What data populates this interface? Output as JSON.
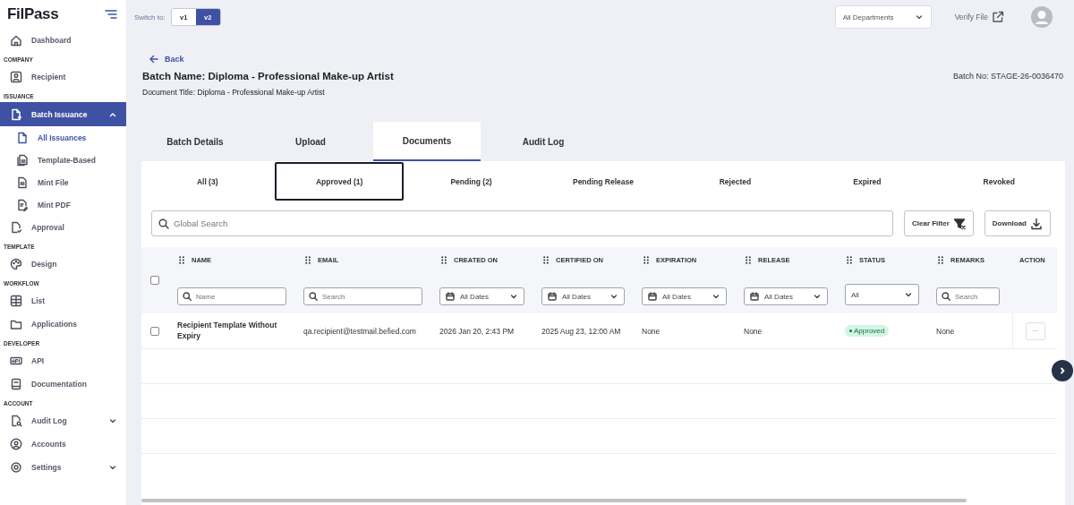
{
  "sidebar": {
    "logo": "FilPass",
    "groups": [
      {
        "items": [
          {
            "label": "Dashboard",
            "selected": false
          }
        ]
      },
      {
        "heading": "COMPANY",
        "items": [
          {
            "label": "Recipient",
            "selected": false
          }
        ]
      },
      {
        "heading": "ISSUANCE",
        "items": [
          {
            "label": "Batch Issuance",
            "selected": true,
            "expanded": true,
            "children": [
              {
                "label": "All Issuances",
                "selected": true
              },
              {
                "label": "Template-Based",
                "selected": false
              },
              {
                "label": "Mint File",
                "selected": false
              },
              {
                "label": "Mint PDF",
                "selected": false
              }
            ]
          },
          {
            "label": "Approval",
            "selected": false
          }
        ]
      },
      {
        "heading": "TEMPLATE",
        "items": [
          {
            "label": "Design",
            "selected": false
          }
        ]
      },
      {
        "heading": "WORKFLOW",
        "items": [
          {
            "label": "List",
            "selected": false
          },
          {
            "label": "Applications",
            "selected": false
          }
        ]
      },
      {
        "heading": "DEVELOPER",
        "items": [
          {
            "label": "API",
            "selected": false
          },
          {
            "label": "Documentation",
            "selected": false
          }
        ]
      },
      {
        "heading": "ACCOUNT",
        "items": [
          {
            "label": "Audit Log",
            "selected": false,
            "expanded": false
          },
          {
            "label": "Accounts",
            "selected": false
          },
          {
            "label": "Settings",
            "selected": false,
            "expanded": false
          }
        ]
      }
    ]
  },
  "topbar": {
    "switch_label": "Switch to:",
    "versions": [
      {
        "label": "v1",
        "selected": false
      },
      {
        "label": "v2",
        "selected": true
      }
    ],
    "department": "All Departments",
    "verify": "Verify File"
  },
  "header": {
    "back": "Back",
    "batch_name": "Batch Name: Diploma - Professional Make-up Artist",
    "document_title": "Document Title: Diploma - Professional Make-up Artist",
    "batch_no": "Batch No: STAGE-26-0036470"
  },
  "tabs": [
    {
      "label": "Batch Details",
      "selected": false
    },
    {
      "label": "Upload",
      "selected": false
    },
    {
      "label": "Documents",
      "selected": true
    },
    {
      "label": "Audit Log",
      "selected": false
    }
  ],
  "status_tabs": [
    {
      "label": "All (3)",
      "selected": false
    },
    {
      "label": "Approved (1)",
      "selected": true
    },
    {
      "label": "Pending (2)",
      "selected": false
    },
    {
      "label": "Pending Release",
      "selected": false
    },
    {
      "label": "Rejected",
      "selected": false
    },
    {
      "label": "Expired",
      "selected": false
    },
    {
      "label": "Revoked",
      "selected": false
    }
  ],
  "search": {
    "placeholder": "Global Search"
  },
  "buttons": [
    "Clear Filter",
    "Download"
  ],
  "table": {
    "select_all": false,
    "columns": [
      {
        "label": "NAME",
        "filter": {
          "kind": "text",
          "placeholder": "Name"
        }
      },
      {
        "label": "EMAIL",
        "filter": {
          "kind": "text",
          "placeholder": "Search"
        }
      },
      {
        "label": "CREATED ON",
        "filter": {
          "kind": "date",
          "value": "All Dates"
        }
      },
      {
        "label": "CERTIFIED ON",
        "filter": {
          "kind": "date",
          "value": "All Dates"
        }
      },
      {
        "label": "EXPIRATION",
        "filter": {
          "kind": "date",
          "value": "All Dates"
        }
      },
      {
        "label": "RELEASE",
        "filter": {
          "kind": "date",
          "value": "All Dates"
        }
      },
      {
        "label": "STATUS",
        "filter": {
          "kind": "select",
          "value": "All"
        }
      },
      {
        "label": "REMARKS",
        "filter": {
          "kind": "text",
          "placeholder": "Search"
        }
      },
      {
        "label": "ACTION"
      }
    ],
    "rows": [
      {
        "checked": false,
        "name": "Recipient Template Without Expiry",
        "email": "qa.recipient@testmail.befied.com",
        "created_on": "2026 Jan 20, 2:43 PM",
        "certified_on": "2025 Aug 23, 12:00 AM",
        "expiration": "None",
        "release": "None",
        "status": "Approved",
        "remarks": "None",
        "action": "···"
      }
    ]
  }
}
